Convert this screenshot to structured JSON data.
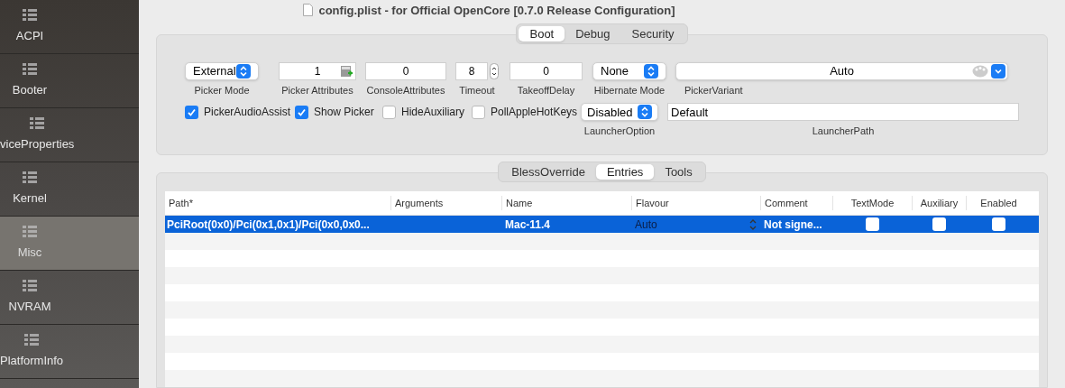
{
  "sidebar": {
    "items": [
      {
        "label": "ACPI",
        "selected": false
      },
      {
        "label": "Booter",
        "selected": false
      },
      {
        "label": "viceProperties",
        "selected": false
      },
      {
        "label": "Kernel",
        "selected": false
      },
      {
        "label": "Misc",
        "selected": true
      },
      {
        "label": "NVRAM",
        "selected": false
      },
      {
        "label": "PlatformInfo",
        "selected": false
      }
    ]
  },
  "window": {
    "title": "config.plist - for Official OpenCore [0.7.0 Release Configuration]"
  },
  "top_tabs": [
    {
      "label": "Boot",
      "selected": true
    },
    {
      "label": "Debug",
      "selected": false
    },
    {
      "label": "Security",
      "selected": false
    }
  ],
  "boot_fields": [
    {
      "kind": "popup",
      "value": "External",
      "label": "Picker Mode"
    },
    {
      "kind": "calc",
      "value": "1",
      "label": "Picker Attributes"
    },
    {
      "kind": "text",
      "value": "0",
      "label": "ConsoleAttributes"
    },
    {
      "kind": "stepper",
      "value": "8",
      "label": "Timeout"
    },
    {
      "kind": "text",
      "value": "0",
      "label": "TakeoffDelay"
    },
    {
      "kind": "popup",
      "value": "None",
      "label": "Hibernate Mode"
    },
    {
      "kind": "combo",
      "value": "Auto",
      "label": "PickerVariant"
    }
  ],
  "boot_checkboxes": [
    {
      "label": "PickerAudioAssist",
      "checked": true
    },
    {
      "label": "Show Picker",
      "checked": true
    },
    {
      "label": "HideAuxiliary",
      "checked": false
    },
    {
      "label": "PollAppleHotKeys",
      "checked": false
    }
  ],
  "launcher_option": {
    "value": "Disabled",
    "label": "LauncherOption"
  },
  "launcher_path": {
    "value": "Default",
    "label": "LauncherPath"
  },
  "sub_tabs": [
    {
      "label": "BlessOverride",
      "selected": false
    },
    {
      "label": "Entries",
      "selected": true
    },
    {
      "label": "Tools",
      "selected": false
    }
  ],
  "table": {
    "columns": [
      "Path*",
      "Arguments",
      "Name",
      "Flavour",
      "Comment",
      "TextMode",
      "Auxiliary",
      "Enabled"
    ],
    "rows": [
      {
        "selected": true,
        "path": "PciRoot(0x0)/Pci(0x1,0x1)/Pci(0x0,0x0...",
        "name": "Mac-11.4",
        "flavour": "Auto",
        "comment": "Not signe...",
        "textmode": false,
        "auxiliary": false,
        "enabled": false
      }
    ]
  }
}
